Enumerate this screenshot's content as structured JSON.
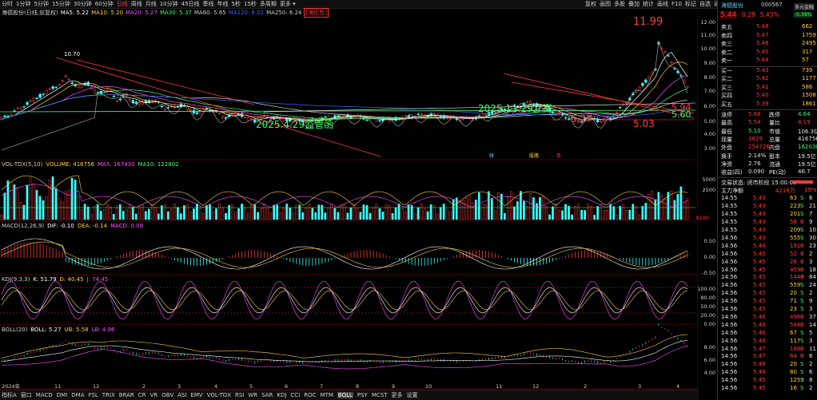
{
  "toolbar": {
    "periods": [
      "分时",
      "1分钟",
      "5分钟",
      "15分钟",
      "30分钟",
      "60分钟",
      "日线",
      "周线",
      "月线",
      "10分钟",
      "45日线",
      "季线",
      "年线",
      "5秒",
      "15秒",
      "多周期",
      "更多 ▾"
    ],
    "active_period": "日线",
    "right_tools": [
      "复权",
      "画图",
      "多股",
      "叠加",
      "统计",
      "画线",
      "F10",
      "标记",
      "自选",
      "返回"
    ]
  },
  "main_legend": {
    "stock": "海德股份(日线,前复权)",
    "items": [
      {
        "text": "MA5: 5.22",
        "color": "#ffffff"
      },
      {
        "text": "MA10: 5.20",
        "color": "#ffd23c"
      },
      {
        "text": "MA20: 5.27",
        "color": "#ff50ff"
      },
      {
        "text": "MA30: 5.37",
        "color": "#3cff6c"
      },
      {
        "text": "MA60: 5.65",
        "color": "#cfcfcf"
      },
      {
        "text": "MA120: 6.02",
        "color": "#3c64ff"
      },
      {
        "text": "MA250: 6.24",
        "color": "#cfcfcf"
      }
    ],
    "boxed": "[海伦哲]"
  },
  "annotations": {
    "high": "11.99",
    "peak_left": "10.70",
    "event1": "2025.4.29监管函",
    "event2": "2025.11.29立案",
    "p1": "5.94",
    "p2": "5.60",
    "p3": "5.27",
    "p4": "5.03",
    "badge1": "财",
    "badge2": "股路",
    "badge3": "条"
  },
  "price_axis": [
    "12.00",
    "11.00",
    "10.00",
    "9.00",
    "8.00",
    "7.00",
    "6.00",
    "5.00",
    "4.00",
    "3.00"
  ],
  "vol_panel": {
    "title": "VOL-TDX(5,10)",
    "items": [
      {
        "text": "VOLUME: 416756",
        "color": "#ffd23c"
      },
      {
        "text": "MA5: 167430",
        "color": "#ff50ff"
      },
      {
        "text": "MA10: 122802",
        "color": "#3cff6c"
      }
    ],
    "axis": [
      "5000",
      "2500"
    ],
    "unit": "X100"
  },
  "macd_panel": {
    "title": "MACD(12,26,9)",
    "items": [
      {
        "text": "DIF: -0.10",
        "color": "#ffffff"
      },
      {
        "text": "DEA: -0.14",
        "color": "#ffd23c"
      },
      {
        "text": "MACD: 0.08",
        "color": "#ff50ff"
      }
    ],
    "axis": [
      "0.50",
      "0.00",
      "-0.50"
    ]
  },
  "kdj_panel": {
    "title": "KDJ(9,3,3)",
    "items": [
      {
        "text": "K: 51.79",
        "color": "#ffffff"
      },
      {
        "text": "D: 40.45",
        "color": "#ffd23c"
      },
      {
        "text": "J: 74.45",
        "color": "#ff50ff"
      }
    ],
    "axis": [
      "100.00",
      "80.00",
      "50.00",
      "20.00",
      "0.00"
    ]
  },
  "boll_panel": {
    "title": "BOLL(20)",
    "items": [
      {
        "text": "BOLL: 5.27",
        "color": "#ffffff"
      },
      {
        "text": "UB: 5.58",
        "color": "#ffd23c"
      },
      {
        "text": "LB: 4.96",
        "color": "#ff50ff"
      }
    ],
    "axis": [
      "8.00",
      "6.00",
      "4.00"
    ]
  },
  "x_axis": {
    "labels": [
      "2024年",
      "11",
      "12",
      "2",
      "3",
      "4",
      "5",
      "6",
      "7",
      "8",
      "9",
      "10",
      "11",
      "12",
      "2",
      "3",
      "4"
    ],
    "mode": "日线"
  },
  "bottom_tabs": [
    "指标A",
    "窗口",
    "MACD",
    "DMI",
    "DMA",
    "FSL",
    "TRIX",
    "BRAR",
    "CR",
    "VR",
    "OBV",
    "ASI",
    "EMV",
    "VOL-TDX",
    "RSI",
    "WR",
    "SAR",
    "KDJ",
    "CCI",
    "ROC",
    "MTM",
    "BOLL",
    "PSY",
    "MCST",
    "更多",
    "设置"
  ],
  "active_tab": "BOLL",
  "quote": {
    "name": "海德股份",
    "code": "000567",
    "tag": "多元金融",
    "tag_change": "-0.39%",
    "price": "5.44",
    "change": "0.28",
    "pct": "5.43%",
    "asks": [
      {
        "label": "卖五",
        "price": "5.48",
        "vol": "662"
      },
      {
        "label": "卖四",
        "price": "5.47",
        "vol": "1759"
      },
      {
        "label": "卖三",
        "price": "5.46",
        "vol": "2495"
      },
      {
        "label": "卖二",
        "price": "5.45",
        "vol": "317"
      },
      {
        "label": "卖一",
        "price": "5.44",
        "vol": "57"
      }
    ],
    "bids": [
      {
        "label": "买一",
        "price": "5.43",
        "vol": "739"
      },
      {
        "label": "买二",
        "price": "5.42",
        "vol": "1177"
      },
      {
        "label": "买三",
        "price": "5.41",
        "vol": "586"
      },
      {
        "label": "买四",
        "price": "5.40",
        "vol": "1508"
      },
      {
        "label": "买五",
        "price": "5.39",
        "vol": "1861"
      }
    ],
    "stats": [
      {
        "l1": "涨停",
        "v1": "5.68",
        "c1": "red",
        "l2": "跌停",
        "v2": "4.64",
        "c2": "green"
      },
      {
        "l1": "最高",
        "v1": "5.54",
        "c1": "red",
        "l2": "量比",
        "v2": "4.19",
        "c2": "red"
      },
      {
        "l1": "最低",
        "v1": "5.10",
        "c1": "green",
        "l2": "市值",
        "v2": "106.3亿",
        "c2": "white"
      },
      {
        "l1": "现量",
        "v1": "3829",
        "c1": "red",
        "l2": "总量",
        "v2": "416756",
        "c2": "white"
      },
      {
        "l1": "外盘",
        "v1": "254726",
        "c1": "red",
        "l2": "内盘",
        "v2": "162030",
        "c2": "green"
      },
      {
        "l1": "换手",
        "v1": "2.14%",
        "c1": "white",
        "l2": "股本",
        "v2": "19.5亿",
        "c2": "white"
      },
      {
        "l1": "净资",
        "v1": "2.76",
        "c1": "white",
        "l2": "流通",
        "v2": "19.5亿",
        "c2": "white"
      },
      {
        "l1": "收益(四)",
        "v1": "0.090",
        "c1": "white",
        "l2": "PE(动)",
        "v2": "46.7",
        "c2": "white"
      }
    ],
    "trade_status": "交易状态: 闭市阶段 15:00:00",
    "main_flow_label": "主力净额",
    "main_flow": "4218万",
    "main_flow_pct": "19%",
    "ticks": [
      {
        "t": "14:55",
        "p": "5.43",
        "v": "63",
        "s": "S",
        "n": "6"
      },
      {
        "t": "14:55",
        "p": "5.43",
        "v": "223",
        "s": "S",
        "n": "21"
      },
      {
        "t": "14:55",
        "p": "5.43",
        "v": "201",
        "s": "S",
        "n": "7"
      },
      {
        "t": "14:55",
        "p": "5.43",
        "v": "58",
        "s": "B",
        "n": "9"
      },
      {
        "t": "14:55",
        "p": "5.43",
        "v": "209",
        "s": "S",
        "n": "10"
      },
      {
        "t": "14:56",
        "p": "5.43",
        "v": "555",
        "s": "S",
        "n": "30"
      },
      {
        "t": "14:56",
        "p": "5.44",
        "v": "191",
        "s": "B",
        "n": "23"
      },
      {
        "t": "14:56",
        "p": "5.45",
        "v": "52",
        "s": "B",
        "n": "2"
      },
      {
        "t": "14:56",
        "p": "5.45",
        "v": "26",
        "s": "B",
        "n": "3"
      },
      {
        "t": "14:56",
        "p": "5.45",
        "v": "459",
        "s": "B",
        "n": "18"
      },
      {
        "t": "14:56",
        "p": "5.45",
        "v": "1449",
        "s": "B",
        "n": "84"
      },
      {
        "t": "14:56",
        "p": "5.45",
        "v": "559",
        "s": "S",
        "n": "24"
      },
      {
        "t": "14:56",
        "p": "5.45",
        "v": "20",
        "s": "S",
        "n": "2"
      },
      {
        "t": "14:56",
        "p": "5.45",
        "v": "71",
        "s": "S",
        "n": "9"
      },
      {
        "t": "14:56",
        "p": "5.45",
        "v": "23",
        "s": "S",
        "n": "3"
      },
      {
        "t": "14:56",
        "p": "5.46",
        "v": "496",
        "s": "B",
        "n": "37"
      },
      {
        "t": "14:56",
        "p": "5.46",
        "v": "588",
        "s": "B",
        "n": "14"
      },
      {
        "t": "14:56",
        "p": "5.46",
        "v": "67",
        "s": "S",
        "n": "5"
      },
      {
        "t": "14:56",
        "p": "5.46",
        "v": "117",
        "s": "S",
        "n": "3"
      },
      {
        "t": "14:56",
        "p": "5.47",
        "v": "188",
        "s": "B",
        "n": "11"
      },
      {
        "t": "14:56",
        "p": "5.47",
        "v": "64",
        "s": "B",
        "n": "6"
      },
      {
        "t": "14:56",
        "p": "5.46",
        "v": "20",
        "s": "S",
        "n": "2"
      },
      {
        "t": "14:56",
        "p": "5.46",
        "v": "80",
        "s": "S",
        "n": "6"
      },
      {
        "t": "14:56",
        "p": "5.45",
        "v": "1253",
        "s": "S",
        "n": "8"
      },
      {
        "t": "14:56",
        "p": "5.45",
        "v": "16",
        "s": "S",
        "n": "2"
      },
      {
        "t": "15:00",
        "p": "5.44",
        "v": "3829",
        "s": "S",
        "n": "217"
      }
    ],
    "close_time_btn": "日线"
  }
}
